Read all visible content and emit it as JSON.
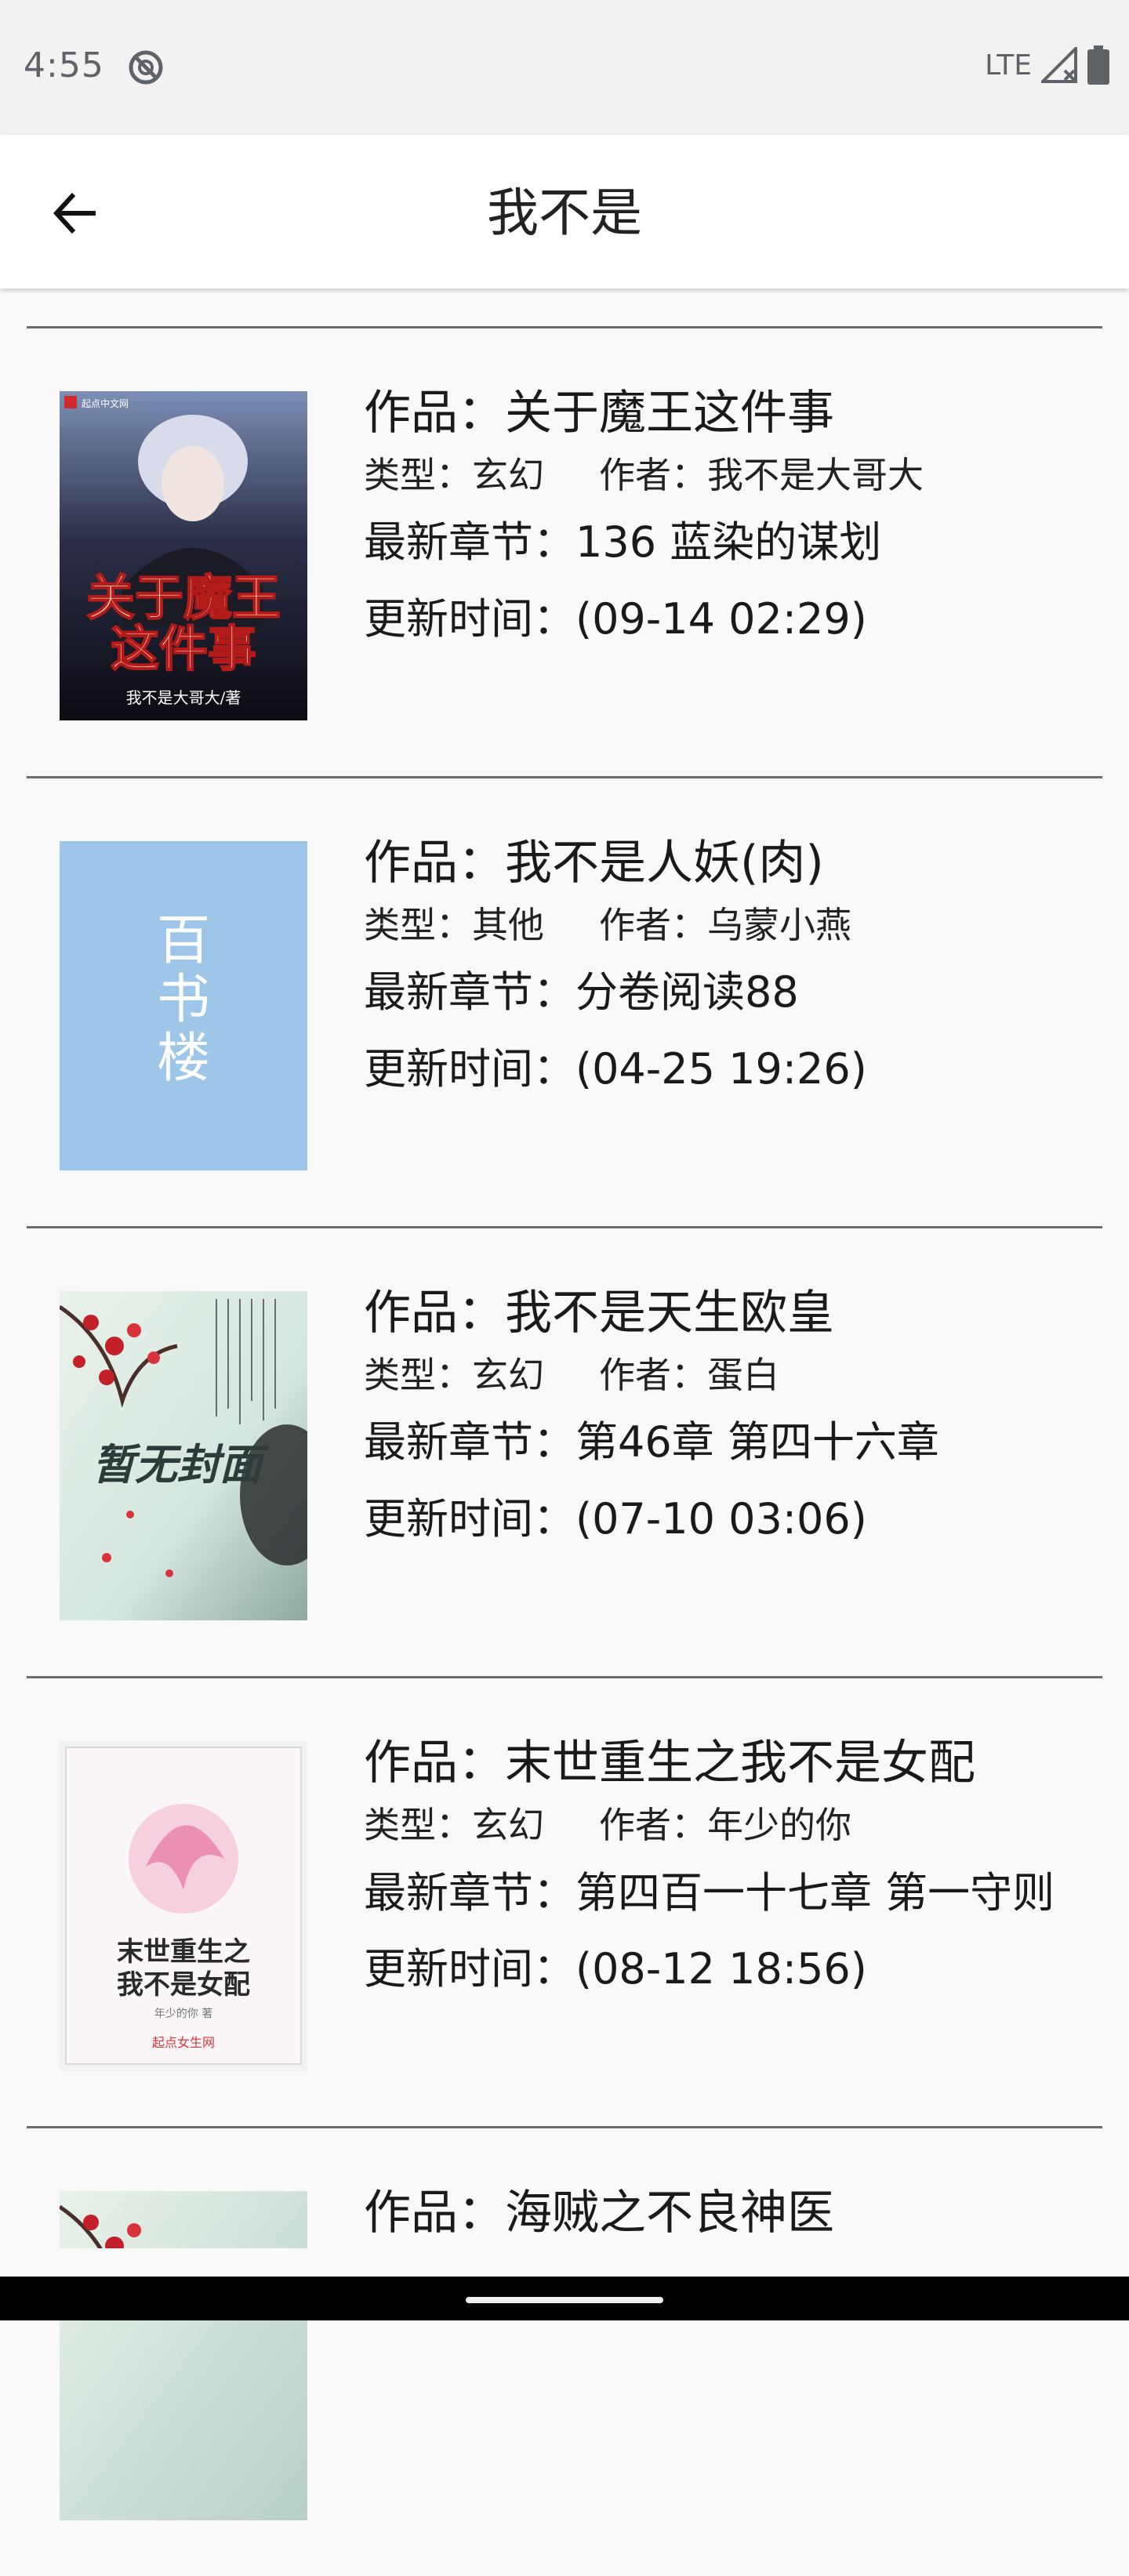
{
  "status_bar": {
    "time": "4:55",
    "network": "LTE",
    "icons": [
      "do-not-disturb-icon",
      "signal-icon",
      "battery-icon"
    ]
  },
  "app_bar": {
    "title": "我不是",
    "back_icon": "arrow-left-icon"
  },
  "books": [
    {
      "title": "作品：关于魔王这件事",
      "genre": "类型：玄幻",
      "author": "作者：我不是大哥大",
      "chapter": "最新章节：136 蓝染的谋划",
      "updated": "更新时间：(09-14 02:29)",
      "cover": {
        "top_text": "起点中文网",
        "main_text": "关于魔王这件事",
        "sub_text": "我不是大哥大/著"
      }
    },
    {
      "title": "作品：我不是人妖(肉)",
      "genre": "类型：其他",
      "author": "作者：乌蒙小燕",
      "chapter": "最新章节：分卷阅读88",
      "updated": "更新时间：(04-25 19:26)",
      "cover": {
        "main_text": "百书楼"
      }
    },
    {
      "title": "作品：我不是天生欧皇",
      "genre": "类型：玄幻",
      "author": "作者：蛋白",
      "chapter": "最新章节：第46章 第四十六章",
      "updated": "更新时间：(07-10 03:06)",
      "cover": {
        "main_text": "暂无封面"
      }
    },
    {
      "title": "作品：末世重生之我不是女配",
      "genre": "类型：玄幻",
      "author": "作者：年少的你",
      "chapter": "最新章节：第四百一十七章 第一守则",
      "updated": "更新时间：(08-12 18:56)",
      "cover": {
        "main_text": "末世重生之我不是女配",
        "sub_text": "年少的你 著",
        "brand": "起点女生网"
      }
    },
    {
      "title": "作品：海贼之不良神医",
      "cover": {
        "main_text": ""
      }
    }
  ]
}
